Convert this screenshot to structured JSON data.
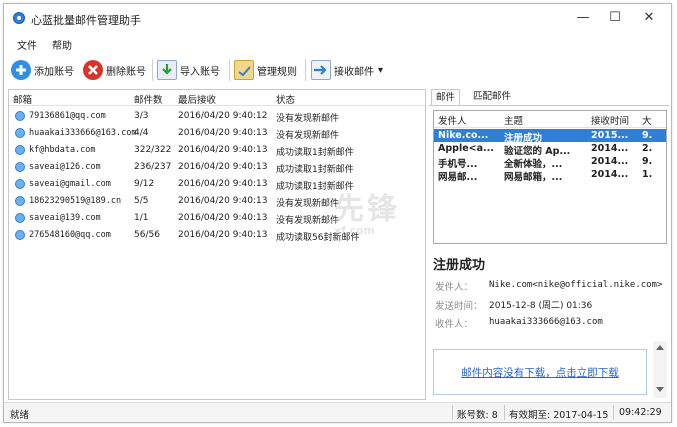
{
  "app": {
    "title": "心蓝批量邮件管理助手"
  },
  "window_controls": {
    "minimize": "—",
    "maximize": "☐",
    "close": "✕"
  },
  "menu": [
    "文件",
    "帮助"
  ],
  "toolbar": {
    "add": "添加账号",
    "delete": "删除账号",
    "import": "导入账号",
    "rules": "管理规则",
    "receive": "接收邮件",
    "dropdown_arrow": "▾"
  },
  "accounts": {
    "headers": [
      "邮箱",
      "邮件数",
      "最后接收",
      "状态"
    ],
    "rows": [
      {
        "email": "79136861@qq.com",
        "count": "3/3",
        "last": "2016/04/20 9:40:12",
        "status": "没有发现新邮件"
      },
      {
        "email": "huaakai333666@163.com",
        "count": "4/4",
        "last": "2016/04/20 9:40:13",
        "status": "没有发现新邮件"
      },
      {
        "email": "kf@hbdata.com",
        "count": "322/322",
        "last": "2016/04/20 9:40:13",
        "status": "成功读取1封新邮件"
      },
      {
        "email": "saveai@126.com",
        "count": "236/237",
        "last": "2016/04/20 9:40:13",
        "status": "成功读取1封新邮件"
      },
      {
        "email": "saveai@gmail.com",
        "count": "9/12",
        "last": "2016/04/20 9:40:13",
        "status": "成功读取1封新邮件"
      },
      {
        "email": "18623290519@189.cn",
        "count": "5/5",
        "last": "2016/04/20 9:40:13",
        "status": "没有发现新邮件"
      },
      {
        "email": "saveai@139.com",
        "count": "1/1",
        "last": "2016/04/20 9:40:13",
        "status": "没有发现新邮件"
      },
      {
        "email": "276548160@qq.com",
        "count": "56/56",
        "last": "2016/04/20 9:40:13",
        "status": "成功读取56封新邮件"
      }
    ]
  },
  "tabs": [
    "邮件",
    "匹配邮件"
  ],
  "inbox": {
    "headers": [
      "发件人",
      "主题",
      "接收时间",
      "大"
    ],
    "rows": [
      {
        "sender": "Nike.co...",
        "subject": "注册成功",
        "time": "2015...",
        "size": "9.",
        "selected": true
      },
      {
        "sender": "Apple<a...",
        "subject": "验证您的 Ap...",
        "time": "2014...",
        "size": "2.",
        "selected": false
      },
      {
        "sender": "手机号...",
        "subject": "全新体验，...",
        "time": "2014...",
        "size": "9.",
        "selected": false
      },
      {
        "sender": "网易邮...",
        "subject": "网易邮箱，...",
        "time": "2014...",
        "size": "1.",
        "selected": false
      }
    ]
  },
  "detail": {
    "subject": "注册成功",
    "from_label": "发件人：",
    "from": "Nike.com<nike@official.nike.com>",
    "time_label": "发送时间：",
    "time": "2015-12-8 (周二) 01:36",
    "to_label": "收件人：",
    "to": "huaakai333666@163.com",
    "download_text": "邮件内容没有下载，点击立即下载"
  },
  "statusbar": {
    "state": "就绪",
    "account_count": "账号数: 8",
    "valid_until": "有效期至: 2017-04-15",
    "clock": "09:42:29"
  },
  "watermark": {
    "text": "先锋",
    "sub": "xf.com"
  }
}
